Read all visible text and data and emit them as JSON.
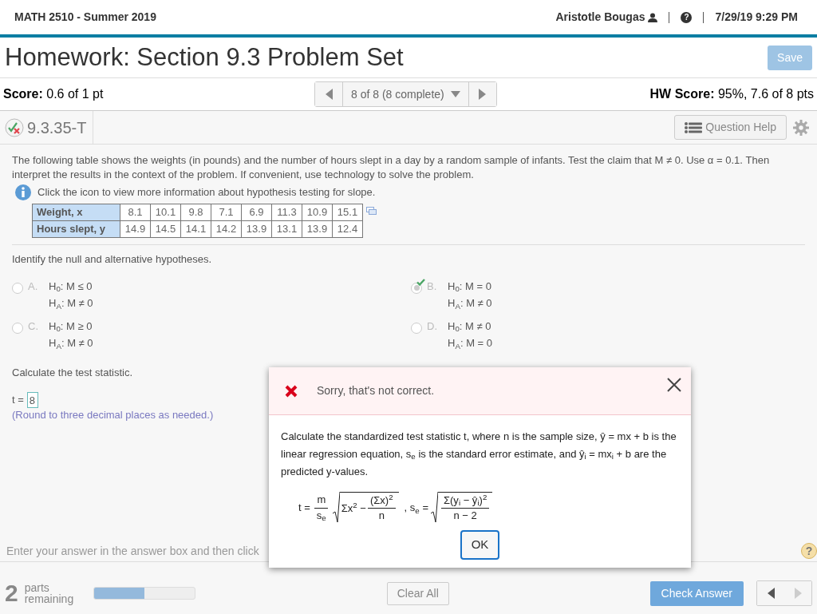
{
  "header": {
    "course": "MATH 2510 - Summer 2019",
    "user": "Aristotle Bougas",
    "help_glyph": "?",
    "datetime": "7/29/19 9:29 PM"
  },
  "title": "Homework: Section 9.3 Problem Set",
  "save_button": {
    "label": "Save",
    "disabled": true
  },
  "score": "**Score:** 0.6 of 1 pt",
  "navigator": {
    "label": "8 of 8 (8 complete)"
  },
  "hw_score": "**HW Score:** 95%, 7.6 of 8 pts",
  "question": {
    "id": "9.3.35-T",
    "help_button": "Question Help"
  },
  "problem": {
    "text": "The following table shows the weights (in pounds) and the number of hours slept in a day by a random sample of infants. Test the claim that M ≠ 0. Use α = 0.1. Then interpret the results in the context of the problem. If convenient, use technology to solve the problem.",
    "info": "Click the icon to view more information about hypothesis testing for slope.",
    "table": [
      {
        "header": "Weight, x",
        "values": [
          "8.1",
          "10.1",
          "9.8",
          "7.1",
          "6.9",
          "11.3",
          "10.9",
          "15.1"
        ]
      },
      {
        "header": "Hours slept, y",
        "values": [
          "14.9",
          "14.5",
          "14.1",
          "14.2",
          "13.9",
          "13.1",
          "13.9",
          "12.4"
        ]
      }
    ]
  },
  "part1": {
    "prompt": "Identify the null and alternative hypotheses.",
    "options": [
      {
        "letter": "A.",
        "h0": "H$_{0}$: M ≤ 0",
        "ha": "H$_{A}$: M ≠ 0",
        "selected": false,
        "correct": false
      },
      {
        "letter": "B.",
        "h0": "H$_{0}$: M = 0",
        "ha": "H$_{A}$: M ≠ 0",
        "selected": true,
        "correct": true
      },
      {
        "letter": "C.",
        "h0": "H$_{0}$: M ≥ 0",
        "ha": "H$_{A}$: M ≠ 0",
        "selected": false,
        "correct": false
      },
      {
        "letter": "D.",
        "h0": "H$_{0}$: M ≠ 0",
        "ha": "H$_{A}$: M = 0",
        "selected": false,
        "correct": false
      }
    ]
  },
  "part2": {
    "prompt": "Calculate the test statistic.",
    "label": "t =",
    "answer": "8",
    "note": "(Round to three decimal places as needed.)"
  },
  "instruction": "Enter your answer in the answer box and then click",
  "footer": {
    "parts_count": "2",
    "parts_label": "parts remaining",
    "progress": {
      "level": 0.5
    },
    "clear_button": "Clear All",
    "check_button": "Check Answer",
    "help_glyph": "?"
  },
  "feedback": {
    "message": "Sorry, that's not correct.",
    "explanation": "Calculate the standardized test statistic t, where n is the sample size, ŷ = mx + b is the linear regression equation, s$_{e}$ is the standard error estimate, and ŷ$_{i}$ = mx$_{i}$ + b are the predicted y-values.",
    "formula": {
      "t_lhs": "t =",
      "t_num": "m",
      "t_den": "s$_{e}$",
      "root1_term": "Σx$^{2}$ −",
      "root1_num": "(Σx)$^{2}$",
      "root1_den": "n",
      "se_lhs": ", s$_{e}$ =",
      "root2_num": "Σ(y$_{i}$ − ŷ$_{i}$)$^{2}$",
      "root2_den": "n − 2"
    },
    "ok_button": "OK"
  }
}
